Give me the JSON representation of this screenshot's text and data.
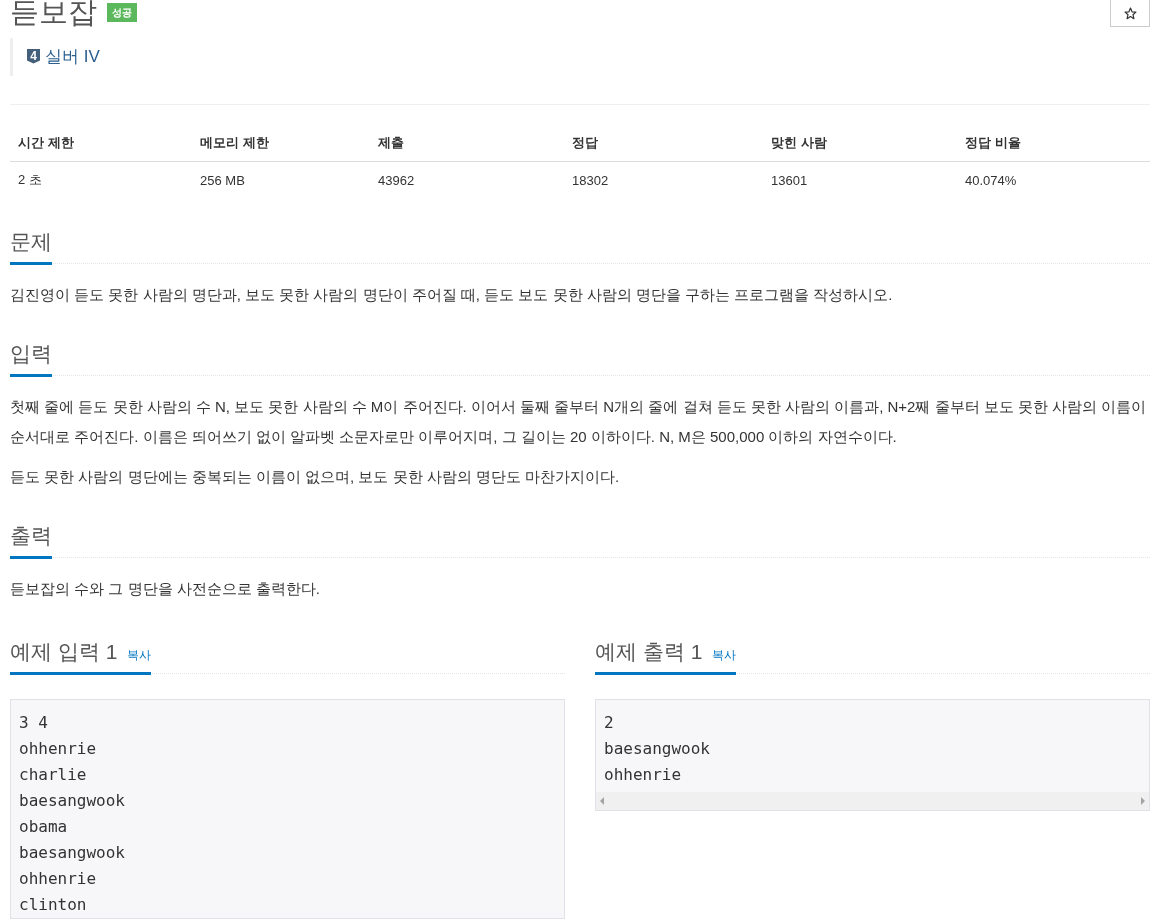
{
  "title": "듣보잡",
  "result_badge": "성공",
  "tier": {
    "badge_number": "4",
    "label": "실버 IV"
  },
  "stats": {
    "columns": [
      "시간 제한",
      "메모리 제한",
      "제출",
      "정답",
      "맞힌 사람",
      "정답 비율"
    ],
    "row": [
      "2 초",
      "256 MB",
      "43962",
      "18302",
      "13601",
      "40.074%"
    ]
  },
  "sections": [
    {
      "heading": "문제",
      "paragraphs": [
        "김진영이 듣도 못한 사람의 명단과, 보도 못한 사람의 명단이 주어질 때, 듣도 보도 못한 사람의 명단을 구하는 프로그램을 작성하시오."
      ]
    },
    {
      "heading": "입력",
      "paragraphs": [
        "첫째 줄에 듣도 못한 사람의 수 N, 보도 못한 사람의 수 M이 주어진다. 이어서 둘째 줄부터 N개의 줄에 걸쳐 듣도 못한 사람의 이름과, N+2째 줄부터 보도 못한 사람의 이름이 순서대로 주어진다. 이름은 띄어쓰기 없이 알파벳 소문자로만 이루어지며, 그 길이는 20 이하이다. N, M은 500,000 이하의 자연수이다.",
        "듣도 못한 사람의 명단에는 중복되는 이름이 없으며, 보도 못한 사람의 명단도 마찬가지이다."
      ]
    },
    {
      "heading": "출력",
      "paragraphs": [
        "듣보잡의 수와 그 명단을 사전순으로 출력한다."
      ]
    }
  ],
  "samples": [
    {
      "heading": "예제 입력 1",
      "copy_link": "복사",
      "lines": [
        "3 4",
        "ohhenrie",
        "charlie",
        "baesangwook",
        "obama",
        "baesangwook",
        "ohhenrie",
        "clinton"
      ]
    },
    {
      "heading": "예제 출력 1",
      "copy_link": "복사",
      "lines": [
        "2",
        "baesangwook",
        "ohhenrie"
      ],
      "scrollbar": true
    }
  ]
}
